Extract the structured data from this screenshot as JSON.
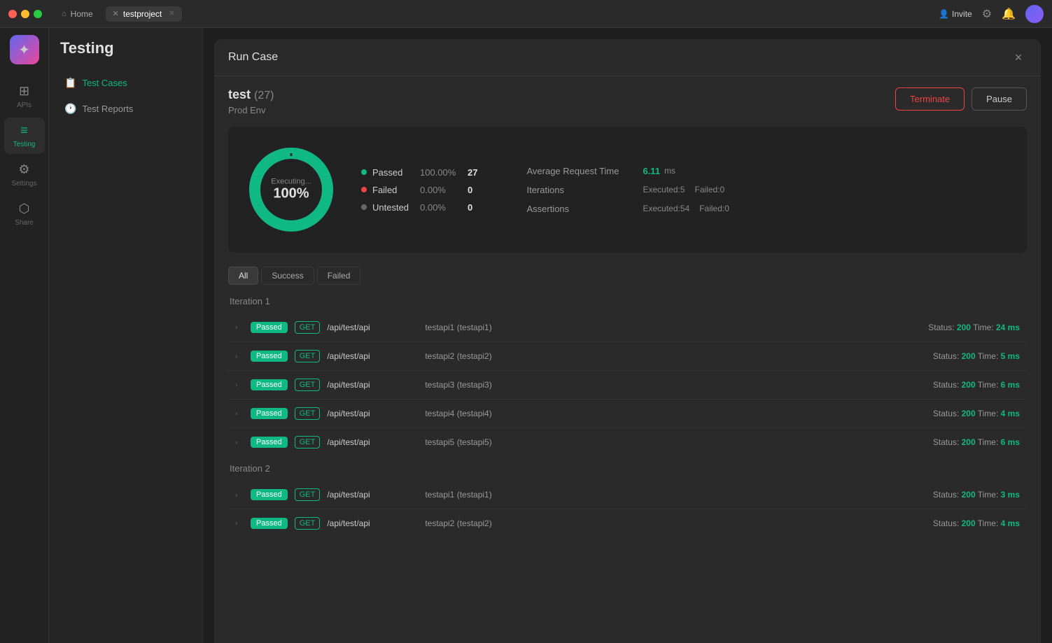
{
  "titlebar": {
    "home_tab": "Home",
    "active_tab": "testproject",
    "invite_label": "Invite",
    "traffic_lights": [
      "red",
      "yellow",
      "green"
    ]
  },
  "sidebar": {
    "items": [
      {
        "id": "apis",
        "label": "APIs",
        "icon": "⊞"
      },
      {
        "id": "testing",
        "label": "Testing",
        "icon": "≡",
        "active": true
      },
      {
        "id": "settings",
        "label": "Settings",
        "icon": "⚙"
      },
      {
        "id": "share",
        "label": "Share",
        "icon": "⬡"
      }
    ]
  },
  "left_panel": {
    "title": "Testing",
    "nav_items": [
      {
        "id": "test-cases",
        "label": "Test Cases",
        "icon": "📋",
        "active": true
      },
      {
        "id": "test-reports",
        "label": "Test Reports",
        "icon": "🕐"
      }
    ]
  },
  "modal": {
    "title": "Run Case",
    "close_label": "×",
    "run_name": "test",
    "run_count": "(27)",
    "run_env": "Prod Env",
    "terminate_label": "Terminate",
    "pause_label": "Pause",
    "donut": {
      "executing_label": "Executing...",
      "percent": "100%",
      "passed_pct": 100,
      "failed_pct": 0
    },
    "legend": [
      {
        "name": "Passed",
        "pct": "100.00%",
        "count": "27",
        "type": "passed"
      },
      {
        "name": "Failed",
        "pct": "0.00%",
        "count": "0",
        "type": "failed"
      },
      {
        "name": "Untested",
        "pct": "0.00%",
        "count": "0",
        "type": "untested"
      }
    ],
    "right_stats": {
      "avg_request_label": "Average Request Time",
      "avg_request_value": "6.11",
      "avg_request_unit": "ms",
      "iterations_label": "Iterations",
      "iterations_executed": "Executed:5",
      "iterations_failed": "Failed:0",
      "assertions_label": "Assertions",
      "assertions_executed": "Executed:54",
      "assertions_failed": "Failed:0"
    },
    "filter_tabs": [
      "All",
      "Success",
      "Failed"
    ],
    "active_filter": "All",
    "iterations": [
      {
        "label": "Iteration 1",
        "rows": [
          {
            "status": "Passed",
            "method": "GET",
            "path": "/api/test/api",
            "name": "testapi1 (testapi1)",
            "code": "200",
            "time": "24 ms"
          },
          {
            "status": "Passed",
            "method": "GET",
            "path": "/api/test/api",
            "name": "testapi2 (testapi2)",
            "code": "200",
            "time": "5 ms"
          },
          {
            "status": "Passed",
            "method": "GET",
            "path": "/api/test/api",
            "name": "testapi3 (testapi3)",
            "code": "200",
            "time": "6 ms"
          },
          {
            "status": "Passed",
            "method": "GET",
            "path": "/api/test/api",
            "name": "testapi4 (testapi4)",
            "code": "200",
            "time": "4 ms"
          },
          {
            "status": "Passed",
            "method": "GET",
            "path": "/api/test/api",
            "name": "testapi5 (testapi5)",
            "code": "200",
            "time": "6 ms"
          }
        ]
      },
      {
        "label": "Iteration 2",
        "rows": [
          {
            "status": "Passed",
            "method": "GET",
            "path": "/api/test/api",
            "name": "testapi1 (testapi1)",
            "code": "200",
            "time": "3 ms"
          },
          {
            "status": "Passed",
            "method": "GET",
            "path": "/api/test/api",
            "name": "testapi2 (testapi2)",
            "code": "200",
            "time": "4 ms"
          }
        ]
      }
    ]
  }
}
